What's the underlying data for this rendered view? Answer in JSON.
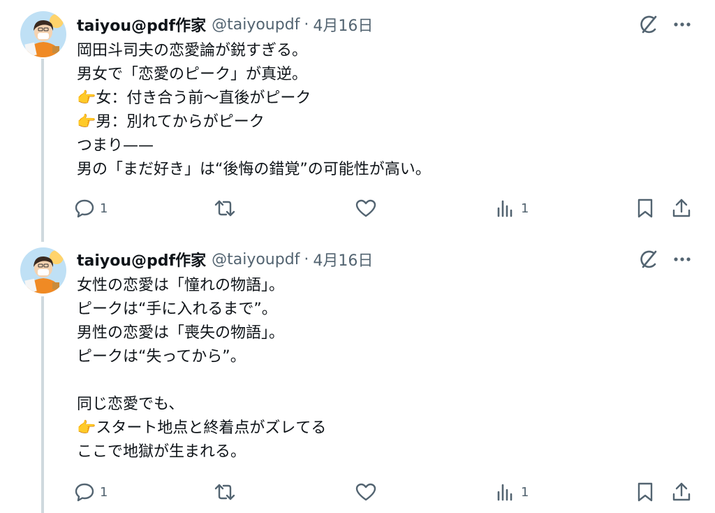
{
  "tweets": [
    {
      "display_name": "taiyou@pdf作家",
      "handle": "@taiyoupdf",
      "date": "4月16日",
      "separator": "·",
      "text": "岡田斗司夫の恋愛論が鋭すぎる。\n男女で「恋愛のピーク」が真逆。\n👉女：付き合う前〜直後がピーク\n👉男：別れてからがピーク\nつまり——\n男の「まだ好き」は“後悔の錯覚”の可能性が高い。",
      "reply_count": "1",
      "view_count": "1"
    },
    {
      "display_name": "taiyou@pdf作家",
      "handle": "@taiyoupdf",
      "date": "4月16日",
      "separator": "·",
      "text": "女性の恋愛は「憧れの物語」。\nピークは“手に入れるまで”。\n男性の恋愛は「喪失の物語」。\nピークは“失ってから”。\n\n同じ恋愛でも、\n👉スタート地点と終着点がズレてる\nここで地獄が生まれる。",
      "reply_count": "1",
      "view_count": "1"
    }
  ],
  "icons": [
    "grok-icon",
    "more-icon",
    "reply-icon",
    "retweet-icon",
    "like-icon",
    "views-icon",
    "bookmark-icon",
    "share-icon"
  ],
  "colors": {
    "text": "#0f1419",
    "muted": "#536471",
    "thread_line": "#cfd9de"
  }
}
